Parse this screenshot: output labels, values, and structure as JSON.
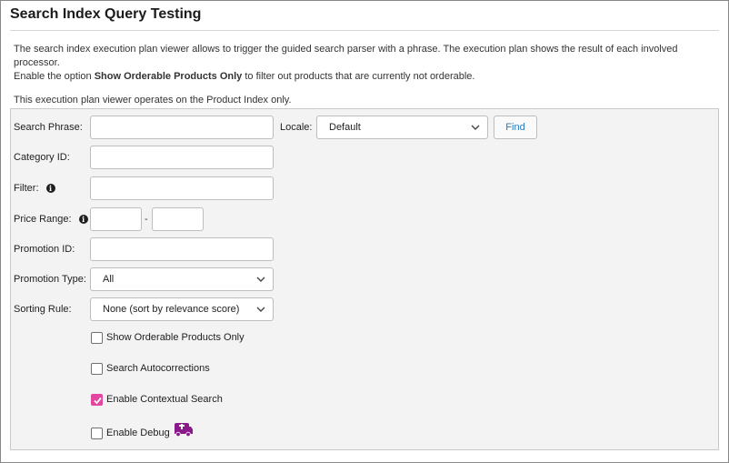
{
  "page": {
    "title": "Search Index Query Testing",
    "description_line1": "The search index execution plan viewer allows to trigger the guided search parser with a phrase. The execution plan shows the result of each involved processor.",
    "description_line2_pre": "Enable the option ",
    "description_line2_bold": "Show Orderable Products Only",
    "description_line2_post": " to filter out products that are currently not orderable.",
    "description_line3": "This execution plan viewer operates on the Product Index only."
  },
  "form": {
    "search_phrase_label": "Search Phrase:",
    "search_phrase_value": "",
    "locale_label": "Locale:",
    "locale_value": "Default",
    "find_label": "Find",
    "category_id_label": "Category ID:",
    "category_id_value": "",
    "filter_label": "Filter:",
    "filter_value": "",
    "price_range_label": "Price Range:",
    "price_min_value": "",
    "price_max_value": "",
    "price_separator": "-",
    "promotion_id_label": "Promotion ID:",
    "promotion_id_value": "",
    "promotion_type_label": "Promotion Type:",
    "promotion_type_value": "All",
    "sorting_rule_label": "Sorting Rule:",
    "sorting_rule_value": "None (sort by relevance score)",
    "show_orderable_label": "Show Orderable Products Only",
    "show_orderable_checked": false,
    "autocorrections_label": "Search Autocorrections",
    "autocorrections_checked": false,
    "contextual_label": "Enable Contextual Search",
    "contextual_checked": true,
    "debug_label": "Enable Debug",
    "debug_checked": false
  },
  "icons": {
    "info": "info-icon",
    "chevron": "chevron-down-icon",
    "debug": "ambulance-icon"
  },
  "colors": {
    "checkbox_accent": "#e2469e",
    "find_text": "#2a7ab8",
    "debug_icon": "#8a1a8a"
  }
}
